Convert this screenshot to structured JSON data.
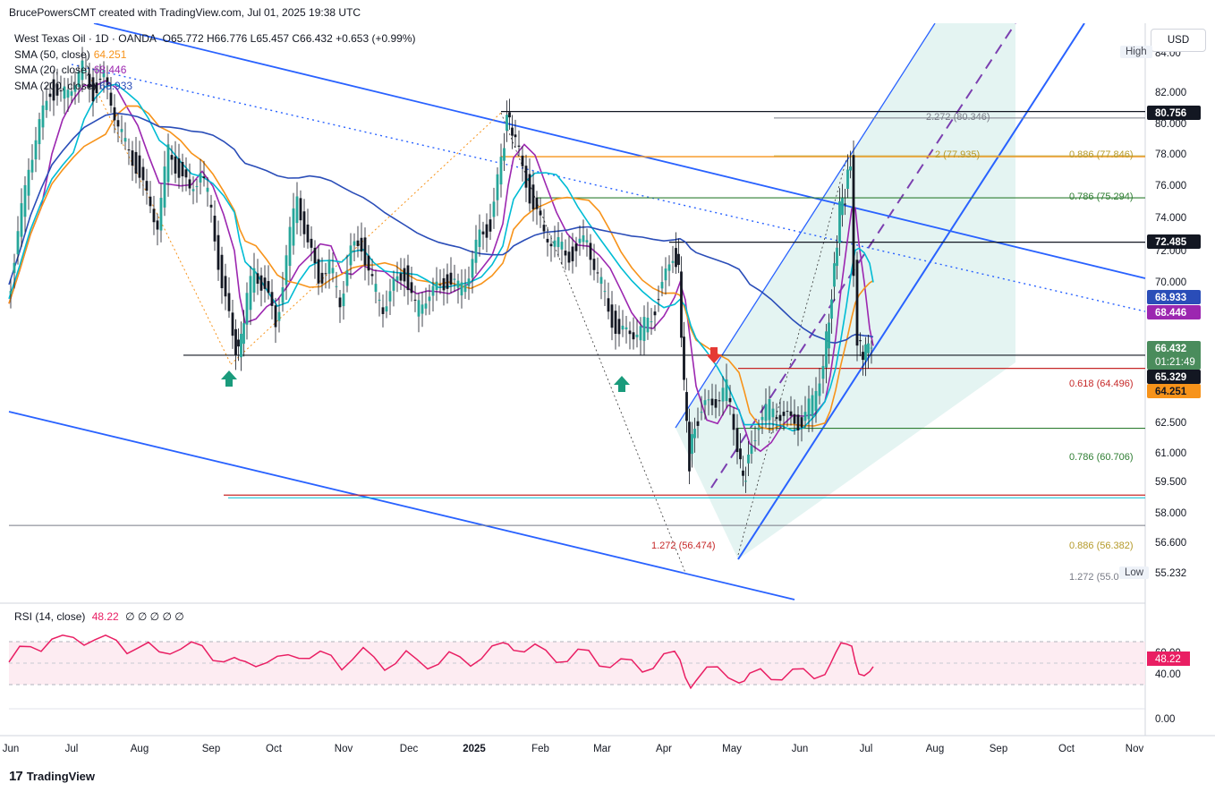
{
  "header": {
    "text": "BrucePowersCMT created with TradingView.com, Jul 01, 2025 19:38 UTC"
  },
  "legend": {
    "symbol": "West Texas Oil · 1D · OANDA",
    "ohlc": "O65.772 H66.776 L65.457 C66.432 +0.653 (+0.99%)",
    "sma50": {
      "label": "SMA (50, close)",
      "value": "64.251",
      "color": "#f7931a"
    },
    "sma20": {
      "label": "SMA (20, close)",
      "value": "68.446",
      "color": "#9c27b0"
    },
    "sma200": {
      "label": "SMA (200, close)",
      "value": "68.933",
      "color": "#2a4db8"
    },
    "sma_teal_color": "#00bcd4"
  },
  "rsi_legend": {
    "label": "RSI (14, close)",
    "value": "48.22",
    "extra": "∅ ∅ ∅ ∅ ∅"
  },
  "currency_button": "USD",
  "high_tag": "High",
  "low_tag": "Low",
  "brand": {
    "logo": "17",
    "name": "TradingView"
  },
  "chart_data": {
    "type": "candlestick",
    "title": "West Texas Oil · 1D · OANDA",
    "y_axis_ticks": [
      "84.00",
      "82.000",
      "80.000",
      "78.000",
      "76.000",
      "74.000",
      "72.000",
      "70.000",
      "68.000",
      "64.000",
      "62.500",
      "61.000",
      "59.500",
      "58.000",
      "56.600",
      "55.232"
    ],
    "x_axis_ticks": [
      "Jun",
      "Jul",
      "Aug",
      "Sep",
      "Oct",
      "Nov",
      "Dec",
      "2025",
      "Feb",
      "Mar",
      "Apr",
      "May",
      "Jun",
      "Jul",
      "Aug",
      "Sep",
      "Oct",
      "Nov"
    ],
    "price_tags": [
      {
        "value": "80.756",
        "bg": "#131722",
        "fg": "#ffffff"
      },
      {
        "value": "72.485",
        "bg": "#131722",
        "fg": "#ffffff"
      },
      {
        "value": "68.933",
        "bg": "#2a4db8",
        "fg": "#ffffff"
      },
      {
        "value": "68.446",
        "bg": "#9c27b0",
        "fg": "#ffffff"
      },
      {
        "value": "66.432",
        "sub": "01:21:49",
        "bg": "#4a8c5c",
        "fg": "#ffffff"
      },
      {
        "value": "65.329",
        "bg": "#131722",
        "fg": "#ffffff"
      },
      {
        "value": "64.251",
        "bg": "#f7931a",
        "fg": "#131722"
      }
    ],
    "level_labels": [
      {
        "text": "2.272 (80.346)",
        "color": "#787b86"
      },
      {
        "text": "2 (77.935)",
        "color": "#b59a2a"
      },
      {
        "text": "0.886 (77.846)",
        "color": "#b59a2a"
      },
      {
        "text": "0.786 (75.294)",
        "color": "#2e7d32"
      },
      {
        "text": "0.618 (64.496)",
        "color": "#c62828"
      },
      {
        "text": "0.786 (60.706)",
        "color": "#2e7d32"
      },
      {
        "text": "1.272 (56.474)",
        "color": "#c62828"
      },
      {
        "text": "0.886 (56.382)",
        "color": "#b59a2a"
      },
      {
        "text": "1.272 (55.0",
        "color": "#787b86"
      }
    ],
    "levels": {
      "high_80_756": 80.756,
      "fib_80_346": 80.346,
      "fib_77_9": 77.9,
      "fib_75_294": 75.294,
      "res_72_485": 72.485,
      "sup_65_329": 65.329,
      "fib_64_496": 64.496,
      "fib_60_706": 60.706,
      "fib_56_474": 56.474,
      "low_55_232": 55.232
    },
    "rsi": {
      "ticks": [
        "60.00",
        "40.00",
        "0.00"
      ],
      "current": "48.22",
      "upper": 70,
      "lower": 30
    },
    "price_close_path": [
      [
        0,
        68.6
      ],
      [
        12,
        72.8
      ],
      [
        24,
        77.5
      ],
      [
        36,
        79.8
      ],
      [
        48,
        82.2
      ],
      [
        60,
        81.5
      ],
      [
        72,
        82.6
      ],
      [
        84,
        83.4
      ],
      [
        96,
        82.0
      ],
      [
        108,
        82.8
      ],
      [
        120,
        80.8
      ],
      [
        132,
        78.5
      ],
      [
        144,
        77.4
      ],
      [
        156,
        75.2
      ],
      [
        168,
        73.8
      ],
      [
        180,
        78.2
      ],
      [
        192,
        77.0
      ],
      [
        204,
        75.5
      ],
      [
        216,
        77.2
      ],
      [
        228,
        74.4
      ],
      [
        240,
        69.8
      ],
      [
        252,
        66.4
      ],
      [
        258,
        65.5
      ],
      [
        264,
        67.8
      ],
      [
        276,
        70.8
      ],
      [
        288,
        69.5
      ],
      [
        300,
        67.2
      ],
      [
        312,
        71.5
      ],
      [
        324,
        75.6
      ],
      [
        336,
        72.2
      ],
      [
        348,
        70.2
      ],
      [
        360,
        71.0
      ],
      [
        372,
        68.8
      ],
      [
        384,
        71.8
      ],
      [
        396,
        72.4
      ],
      [
        408,
        69.8
      ],
      [
        420,
        68.5
      ],
      [
        432,
        69.6
      ],
      [
        444,
        70.6
      ],
      [
        456,
        68.2
      ],
      [
        468,
        69.2
      ],
      [
        480,
        69.4
      ],
      [
        492,
        70.1
      ],
      [
        504,
        69.5
      ],
      [
        516,
        70.7
      ],
      [
        528,
        72.8
      ],
      [
        540,
        73.6
      ],
      [
        552,
        77.5
      ],
      [
        558,
        80.4
      ],
      [
        564,
        79.8
      ],
      [
        576,
        77.0
      ],
      [
        588,
        74.8
      ],
      [
        600,
        73.0
      ],
      [
        612,
        72.7
      ],
      [
        624,
        71.6
      ],
      [
        636,
        71.9
      ],
      [
        648,
        72.7
      ],
      [
        660,
        70.4
      ],
      [
        672,
        68.3
      ],
      [
        684,
        66.4
      ],
      [
        696,
        67.0
      ],
      [
        708,
        66.8
      ],
      [
        720,
        67.9
      ],
      [
        732,
        69.5
      ],
      [
        744,
        71.8
      ],
      [
        750,
        70.5
      ],
      [
        756,
        63.5
      ],
      [
        762,
        58.5
      ],
      [
        768,
        61.0
      ],
      [
        780,
        61.9
      ],
      [
        792,
        62.6
      ],
      [
        804,
        63.2
      ],
      [
        816,
        59.8
      ],
      [
        822,
        57.4
      ],
      [
        828,
        58.5
      ],
      [
        840,
        61.3
      ],
      [
        852,
        62.0
      ],
      [
        864,
        61.7
      ],
      [
        876,
        61.0
      ],
      [
        888,
        61.2
      ],
      [
        900,
        62.4
      ],
      [
        912,
        65.0
      ],
      [
        918,
        67.6
      ],
      [
        924,
        70.6
      ],
      [
        930,
        74.8
      ],
      [
        936,
        75.4
      ],
      [
        942,
        77.6
      ],
      [
        946,
        70.8
      ],
      [
        950,
        65.8
      ],
      [
        956,
        65.6
      ],
      [
        962,
        65.9
      ],
      [
        966,
        66.4
      ]
    ]
  }
}
